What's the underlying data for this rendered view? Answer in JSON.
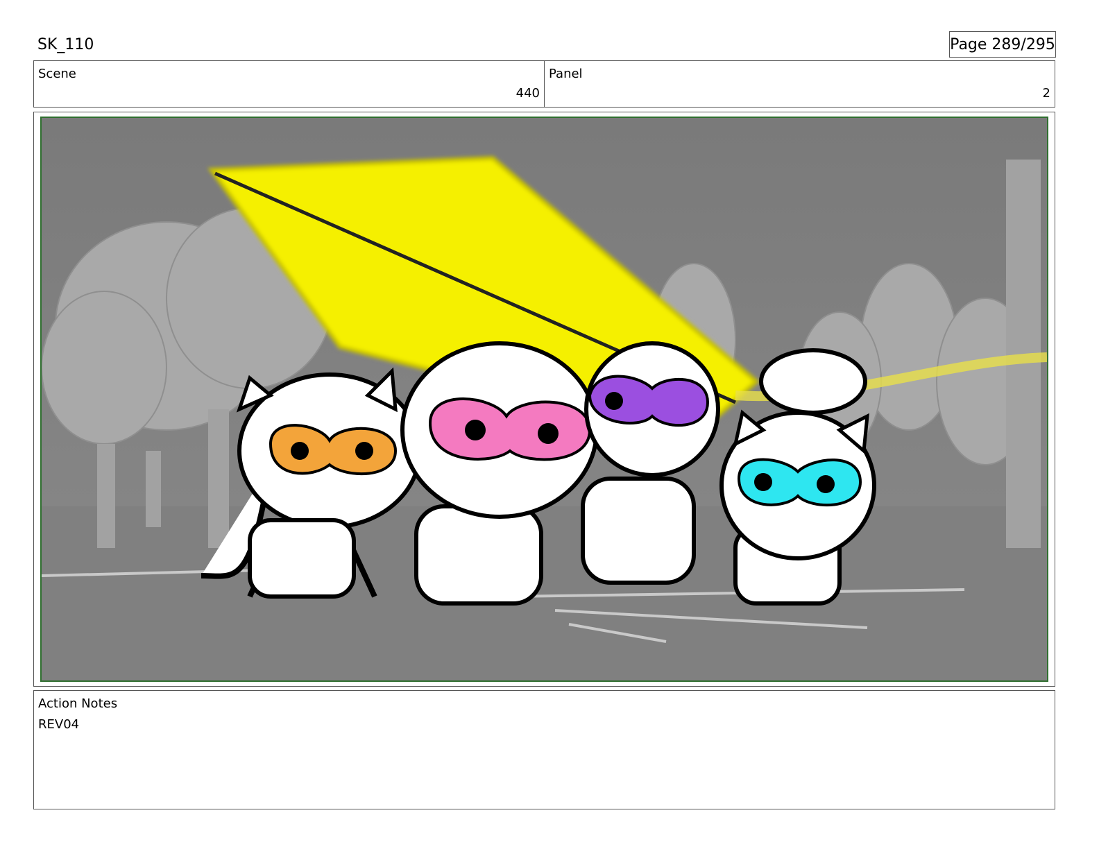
{
  "header": {
    "title": "SK_110",
    "page": "Page 289/295"
  },
  "scene": {
    "label": "Scene",
    "value": "440"
  },
  "panel": {
    "label": "Panel",
    "value": "2"
  },
  "notes": {
    "label": "Action Notes",
    "text": "REV04"
  },
  "colors": {
    "frame_border": "#2f6f2f",
    "background_gray": "#7d7d7d",
    "beam_yellow": "#f5f000",
    "mask_orange": "#f3a43a",
    "mask_pink": "#f47ac0",
    "mask_purple": "#9b4fe0",
    "mask_cyan": "#2ee6f0"
  }
}
